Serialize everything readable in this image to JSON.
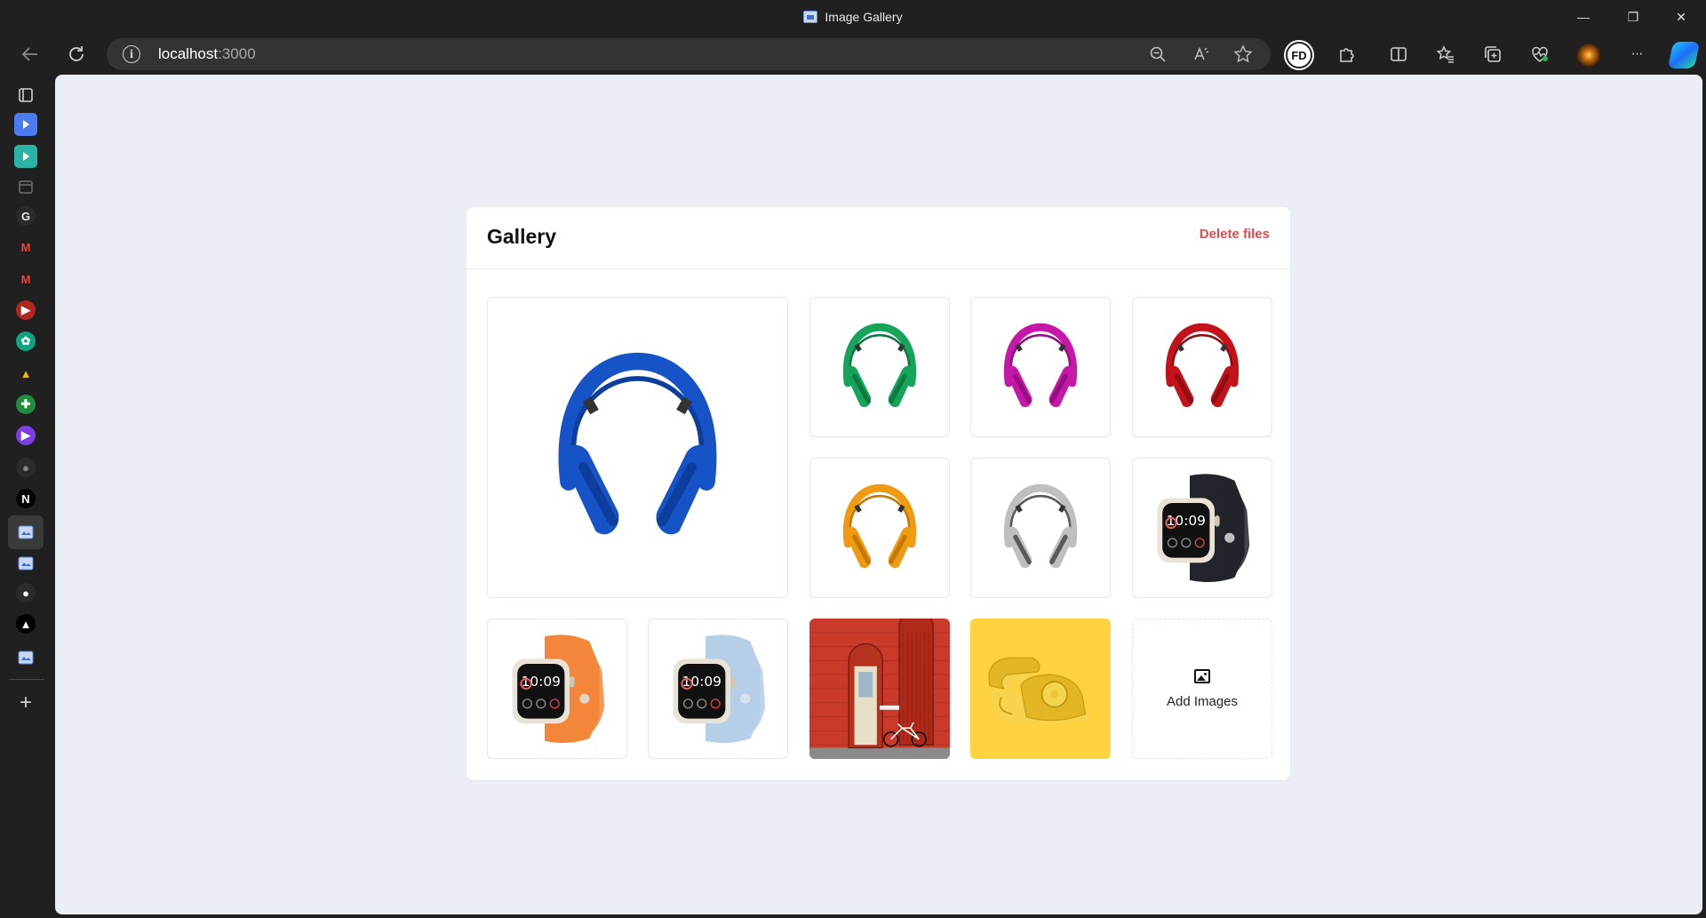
{
  "window": {
    "title": "Image Gallery",
    "minimize_glyph": "—",
    "restore_glyph": "❐",
    "close_glyph": "✕"
  },
  "address_bar": {
    "host": "localhost",
    "port": ":3000"
  },
  "toolbar": {
    "extension_badge": "FD",
    "more_glyph": "···"
  },
  "sidebar": {
    "items": [
      {
        "name": "tab-actions-icon"
      },
      {
        "name": "media-play-icon",
        "color": "#4a7cf0"
      },
      {
        "name": "media-play-icon-2",
        "color": "#2bb3a8"
      },
      {
        "name": "calendar-icon"
      },
      {
        "name": "google-icon",
        "glyph": "G"
      },
      {
        "name": "gmail-icon",
        "glyph": "M"
      },
      {
        "name": "gmail-icon-2",
        "glyph": "M"
      },
      {
        "name": "youtube-icon",
        "glyph": "▶"
      },
      {
        "name": "chatgpt-icon",
        "glyph": "✿"
      },
      {
        "name": "google-drive-icon",
        "glyph": "▲"
      },
      {
        "name": "google-sheets-icon",
        "glyph": "✚"
      },
      {
        "name": "app-icon",
        "glyph": "▶"
      },
      {
        "name": "github-icon",
        "glyph": "●"
      },
      {
        "name": "nextjs-icon",
        "glyph": "N"
      },
      {
        "name": "image-gallery-icon"
      },
      {
        "name": "image-gallery-icon-2"
      },
      {
        "name": "github-icon-2",
        "glyph": "●"
      },
      {
        "name": "vercel-icon",
        "glyph": "▲"
      },
      {
        "name": "image-gallery-icon-3"
      }
    ],
    "add_glyph": "+"
  },
  "gallery": {
    "title": "Gallery",
    "delete_label": "Delete files",
    "add_images_label": "Add Images",
    "images": [
      {
        "name": "headphones-blue",
        "kind": "headphones",
        "color": "#1553c7",
        "dark": "#0d3e9e"
      },
      {
        "name": "headphones-green",
        "kind": "headphones",
        "color": "#16a35a",
        "dark": "#0e7a42"
      },
      {
        "name": "headphones-magenta",
        "kind": "headphones",
        "color": "#c517a8",
        "dark": "#94107e"
      },
      {
        "name": "headphones-red",
        "kind": "headphones",
        "color": "#c4121a",
        "dark": "#8e0c12"
      },
      {
        "name": "headphones-orange",
        "kind": "headphones",
        "color": "#f09a12",
        "dark": "#c47808"
      },
      {
        "name": "headphones-silver",
        "kind": "headphones",
        "color": "#bfbfbf",
        "dark": "#5a5a5a"
      },
      {
        "name": "watch-black",
        "kind": "watch",
        "color": "#22252b",
        "case": "#e9e2d6"
      },
      {
        "name": "watch-orange",
        "kind": "watch",
        "color": "#f3863a",
        "case": "#e9e2d6"
      },
      {
        "name": "watch-light-blue",
        "kind": "watch",
        "color": "#b4cfe6",
        "case": "#e9e2d6"
      },
      {
        "name": "red-wall-door-bicycle",
        "kind": "door",
        "color": "#c93a2b",
        "dark": "#9a2a1e"
      },
      {
        "name": "yellow-rotary-phone",
        "kind": "phone",
        "color": "#ffd23f",
        "dark": "#e2b524"
      }
    ],
    "watch_time": "10:09"
  }
}
